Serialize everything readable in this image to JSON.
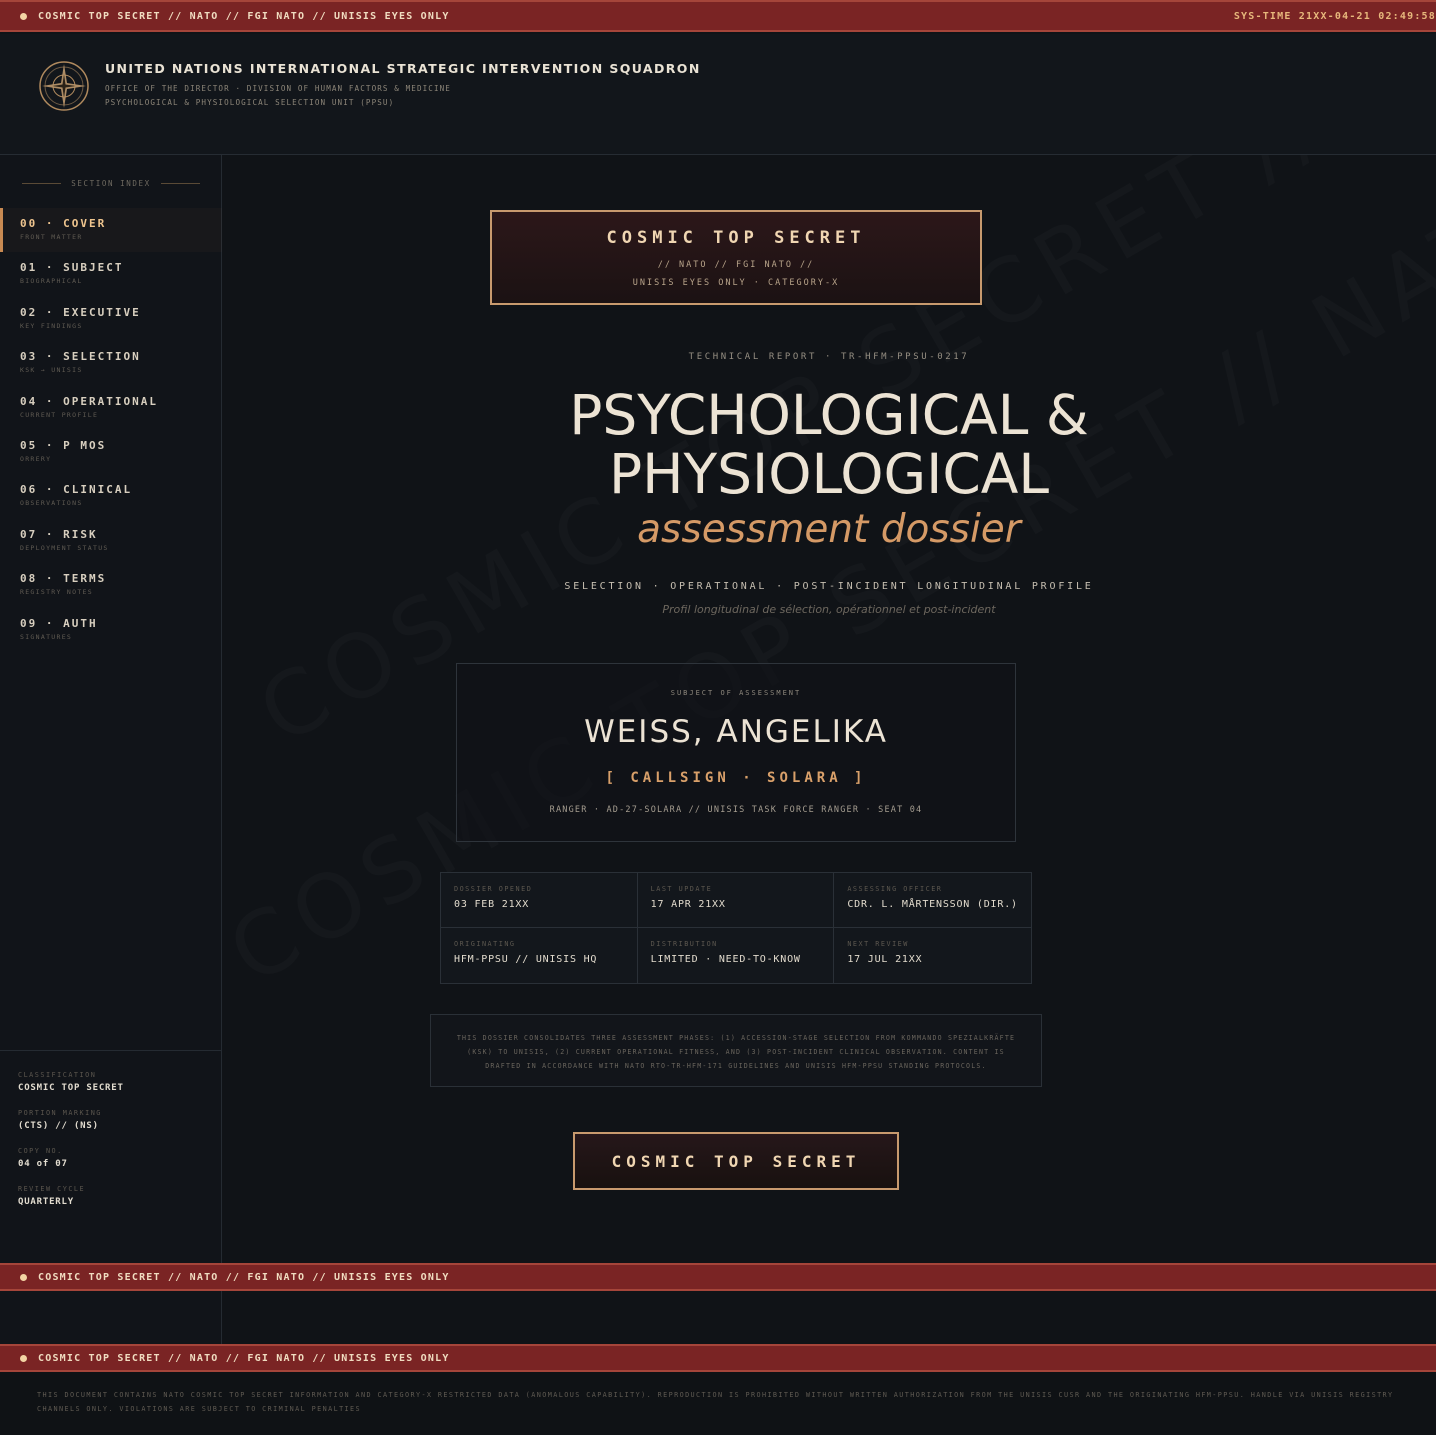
{
  "banner": {
    "classification": "COSMIC TOP SECRET // NATO // FGI NATO // UNISIS EYES ONLY",
    "systime": "SYS-TIME 21XX-04-21 02:49:58"
  },
  "header": {
    "org_name": "UNITED NATIONS INTERNATIONAL STRATEGIC INTERVENTION SQUADRON",
    "line1": "OFFICE OF THE DIRECTOR · DIVISION OF HUMAN FACTORS & MEDICINE",
    "line2": "PSYCHOLOGICAL & PHYSIOLOGICAL SELECTION UNIT (PPSU)",
    "emblem_icon": "compass-star-emblem"
  },
  "sidebar": {
    "section_index": "SECTION INDEX",
    "items": [
      {
        "label": "00 · COVER",
        "sub": "FRONT MATTER"
      },
      {
        "label": "01 · SUBJECT",
        "sub": "BIOGRAPHICAL"
      },
      {
        "label": "02 · EXECUTIVE",
        "sub": "KEY FINDINGS"
      },
      {
        "label": "03 · SELECTION",
        "sub": "KSK → UNISIS"
      },
      {
        "label": "04 · OPERATIONAL",
        "sub": "CURRENT PROFILE"
      },
      {
        "label": "05 · P MOS",
        "sub": "ORRERY"
      },
      {
        "label": "06 · CLINICAL",
        "sub": "OBSERVATIONS"
      },
      {
        "label": "07 · RISK",
        "sub": "DEPLOYMENT STATUS"
      },
      {
        "label": "08 · TERMS",
        "sub": "REGISTRY NOTES"
      },
      {
        "label": "09 · AUTH",
        "sub": "SIGNATURES"
      }
    ],
    "meta": [
      {
        "key": "CLASSIFICATION",
        "value": "COSMIC TOP SECRET"
      },
      {
        "key": "PORTION MARKING",
        "value": "(CTS) // (NS)"
      },
      {
        "key": "COPY NO.",
        "value": "04 of 07"
      },
      {
        "key": "REVIEW CYCLE",
        "value": "QUARTERLY"
      }
    ]
  },
  "cover": {
    "class_box": {
      "title": "COSMIC TOP SECRET",
      "line1": "// NATO // FGI NATO //",
      "line2": "UNISIS EYES ONLY · CATEGORY-X"
    },
    "report_id": "TECHNICAL REPORT · TR-HFM-PPSU-0217",
    "title_line1": "PSYCHOLOGICAL &",
    "title_line2": "PHYSIOLOGICAL",
    "title_line3": "assessment dossier",
    "phases": "SELECTION · OPERATIONAL · POST-INCIDENT LONGITUDINAL PROFILE",
    "french": "Profil longitudinal de sélection, opérationnel et post-incident",
    "subject": {
      "label": "SUBJECT OF ASSESSMENT",
      "name": "WEISS, ANGELIKA",
      "callsign": "[ CALLSIGN · SOLARA ]",
      "unit": "RANGER · AD-27-SOLARA // UNISIS TASK FORCE RANGER · SEAT 04"
    },
    "facts": [
      {
        "key": "DOSSIER OPENED",
        "value": "03 FEB 21XX"
      },
      {
        "key": "LAST UPDATE",
        "value": "17 APR 21XX"
      },
      {
        "key": "ASSESSING OFFICER",
        "value": "CDR. L. MÅRTENSSON (DIR.)"
      },
      {
        "key": "ORIGINATING",
        "value": "HFM-PPSU // UNISIS HQ"
      },
      {
        "key": "DISTRIBUTION",
        "value": "LIMITED · NEED-TO-KNOW"
      },
      {
        "key": "NEXT REVIEW",
        "value": "17 JUL 21XX"
      }
    ],
    "note": "THIS DOSSIER CONSOLIDATES THREE ASSESSMENT PHASES: (1) ACCESSION-STAGE SELECTION FROM KOMMANDO SPEZIALKRÄFTE (KSK) TO UNISIS, (2) CURRENT OPERATIONAL FITNESS, AND (3) POST-INCIDENT CLINICAL OBSERVATION. CONTENT IS DRAFTED IN ACCORDANCE WITH NATO RTO-TR-HFM-171 GUIDELINES AND UNISIS HFM-PPSU STANDING PROTOCOLS.",
    "stamp": "COSMIC TOP SECRET",
    "watermark": "COSMIC TOP SECRET // NATO // UNISIS"
  },
  "footer": {
    "text": "THIS DOCUMENT CONTAINS NATO COSMIC TOP SECRET INFORMATION AND CATEGORY-X RESTRICTED DATA (ANOMALOUS CAPABILITY). REPRODUCTION IS PROHIBITED WITHOUT WRITTEN AUTHORIZATION FROM THE UNISIS CUSR AND THE ORIGINATING HFM-PPSU. HANDLE VIA UNISIS REGISTRY CHANNELS ONLY. VIOLATIONS ARE SUBJECT TO CRIMINAL PENALTIES"
  },
  "colors": {
    "banner_red": "#7a2424",
    "accent_gold": "#c89a6e",
    "accent_orange": "#d59a66",
    "background": "#101317"
  }
}
